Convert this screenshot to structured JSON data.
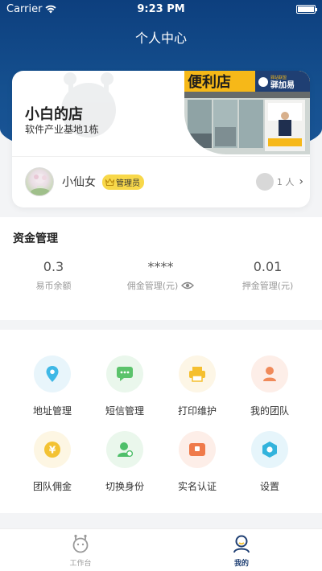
{
  "status": {
    "carrier": "Carrier",
    "time": "9:23 PM"
  },
  "header": {
    "title": "个人中心"
  },
  "store": {
    "name": "小白的店",
    "address": "软件产业基地1栋",
    "photo_sign": "便利店",
    "photo_brand": "驿加易",
    "photo_brand_small": "驿站联盟"
  },
  "user": {
    "name": "小仙女",
    "role": "管理员",
    "member_count": "1 人"
  },
  "funds": {
    "title": "资金管理",
    "items": [
      {
        "value": "0.3",
        "label": "易币余额"
      },
      {
        "value": "****",
        "label": "佣金管理(元)"
      },
      {
        "value": "0.01",
        "label": "押金管理(元)"
      }
    ]
  },
  "menu": [
    {
      "label": "地址管理",
      "icon": "location-icon",
      "bg": "#e8f5fb",
      "color": "#3fb8e6"
    },
    {
      "label": "短信管理",
      "icon": "message-icon",
      "bg": "#eaf7ec",
      "color": "#5bc36b"
    },
    {
      "label": "打印维护",
      "icon": "printer-icon",
      "bg": "#fdf6e6",
      "color": "#f5bf2f"
    },
    {
      "label": "我的团队",
      "icon": "team-icon",
      "bg": "#fdeee8",
      "color": "#f08a5a"
    },
    {
      "label": "团队佣金",
      "icon": "coin-icon",
      "bg": "#fdf6e3",
      "color": "#f3c233"
    },
    {
      "label": "切换身份",
      "icon": "switch-user-icon",
      "bg": "#eaf7ec",
      "color": "#4fbf6a"
    },
    {
      "label": "实名认证",
      "icon": "id-card-icon",
      "bg": "#fdeee8",
      "color": "#ef7a4a"
    },
    {
      "label": "设置",
      "icon": "settings-icon",
      "bg": "#e6f5fb",
      "color": "#33b3dc"
    }
  ],
  "tabs": [
    {
      "label": "工作台",
      "active": false
    },
    {
      "label": "我的",
      "active": true
    }
  ],
  "colors": {
    "header": "#0d3f7e",
    "active_tab": "#1f3f73",
    "inactive_tab": "#999999"
  }
}
